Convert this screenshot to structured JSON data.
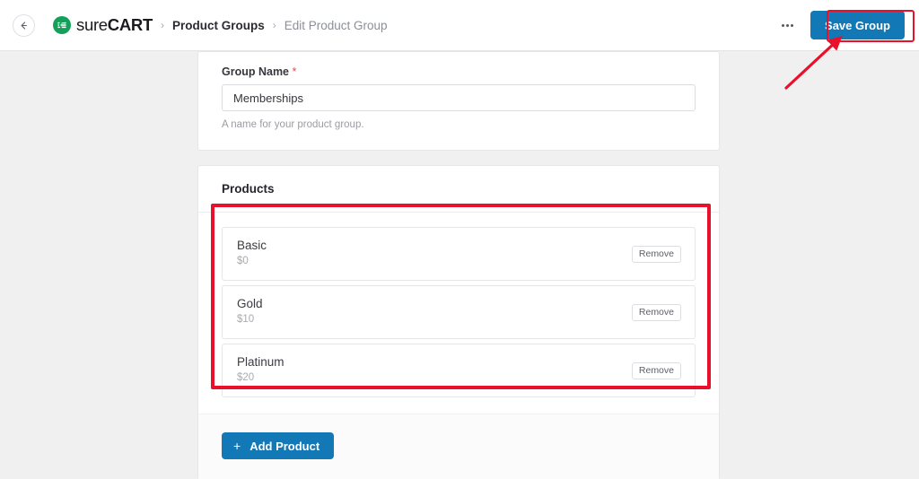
{
  "topbar": {
    "back_icon": "arrow-left-icon",
    "brand_light": "sure",
    "brand_bold": "CART",
    "brand_mark_icon": "surecart-logo-icon",
    "separator": "›",
    "breadcrumb_parent": "Product Groups",
    "breadcrumb_current": "Edit Product Group",
    "kebab_icon": "ellipsis-icon",
    "save_label": "Save Group"
  },
  "form": {
    "group_name_label": "Group Name",
    "required_marker": "*",
    "group_name_value": "Memberships",
    "group_name_placeholder": "Group Name",
    "group_name_help": "A name for your product group."
  },
  "products": {
    "section_title": "Products",
    "remove_label": "Remove",
    "items": [
      {
        "name": "Basic",
        "price": "$0"
      },
      {
        "name": "Gold",
        "price": "$10"
      },
      {
        "name": "Platinum",
        "price": "$20"
      }
    ],
    "add_plus": "+",
    "add_label": "Add Product"
  },
  "colors": {
    "accent_blue": "#1378b6",
    "brand_green": "#13a05a",
    "annotation_red": "#e8102a",
    "required_red": "#d94f4f",
    "page_bg": "#f0f0f1"
  }
}
